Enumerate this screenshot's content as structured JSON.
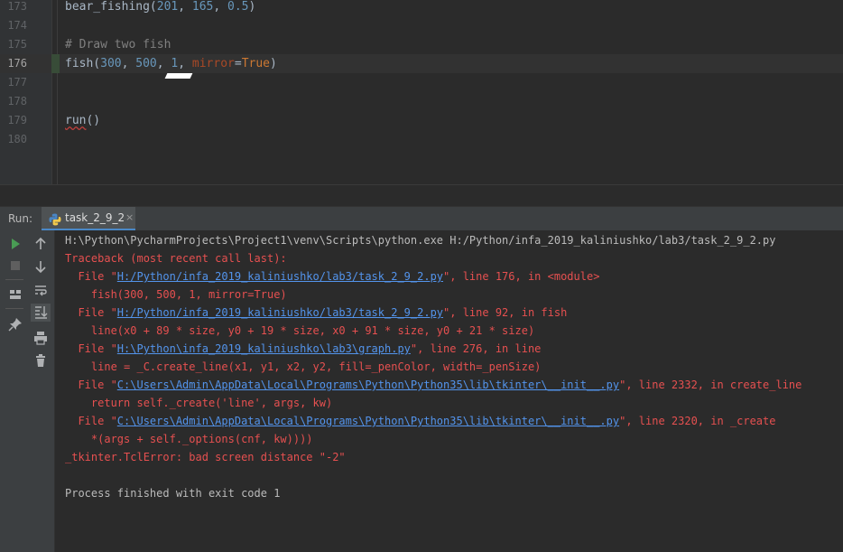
{
  "editor": {
    "lines": [
      {
        "num": "173",
        "parts": [
          {
            "t": "bear_fishing(",
            "c": ""
          },
          {
            "t": "201",
            "c": "num"
          },
          {
            "t": ", ",
            "c": ""
          },
          {
            "t": "165",
            "c": "num"
          },
          {
            "t": ", ",
            "c": ""
          },
          {
            "t": "0.5",
            "c": "num hl"
          },
          {
            "t": ")",
            "c": ""
          }
        ]
      },
      {
        "num": "174",
        "parts": []
      },
      {
        "num": "175",
        "parts": [
          {
            "t": "# Draw two fish",
            "c": "cm"
          }
        ]
      },
      {
        "num": "176",
        "current": true,
        "parts": [
          {
            "t": "fish(",
            "c": ""
          },
          {
            "t": "300",
            "c": "num"
          },
          {
            "t": ", ",
            "c": ""
          },
          {
            "t": "500",
            "c": "num"
          },
          {
            "t": ", ",
            "c": ""
          },
          {
            "t": "1",
            "c": "num"
          },
          {
            "t": ", ",
            "c": ""
          },
          {
            "t": "mirror",
            "c": "kw"
          },
          {
            "t": "=",
            "c": ""
          },
          {
            "t": "True",
            "c": "kwv"
          },
          {
            "t": ")",
            "c": ""
          }
        ]
      },
      {
        "num": "177",
        "parts": []
      },
      {
        "num": "178",
        "parts": []
      },
      {
        "num": "179",
        "parts": [
          {
            "t": "run",
            "c": "run"
          },
          {
            "t": "()",
            "c": ""
          }
        ]
      },
      {
        "num": "180",
        "parts": []
      }
    ]
  },
  "run_panel": {
    "label": "Run:",
    "tab": {
      "label": "task_2_9_2",
      "close": "×"
    },
    "toolbar_icons": [
      "play-icon",
      "stop-icon",
      "arrow-up-icon",
      "arrow-down-icon",
      "soft-wrap-icon",
      "scroll-to-end-icon",
      "layout-icon",
      "pin-icon",
      "print-icon",
      "trash-icon"
    ]
  },
  "console": {
    "lines": [
      {
        "kind": "plain",
        "parts": [
          {
            "t": "H:\\Python\\PycharmProjects\\Project1\\venv\\Scripts\\python.exe H:/Python/infa_2019_kaliniushko/lab3/task_2_9_2.py"
          }
        ]
      },
      {
        "kind": "err",
        "parts": [
          {
            "t": "Traceback (most recent call last):"
          }
        ]
      },
      {
        "kind": "err",
        "parts": [
          {
            "t": "  File \""
          },
          {
            "t": "H:/Python/infa_2019_kaliniushko/lab3/task_2_9_2.py",
            "link": true
          },
          {
            "t": "\", line 176, in <module>"
          }
        ]
      },
      {
        "kind": "err",
        "parts": [
          {
            "t": "    fish(300, 500, 1, mirror=True)"
          }
        ]
      },
      {
        "kind": "err",
        "parts": [
          {
            "t": "  File \""
          },
          {
            "t": "H:/Python/infa_2019_kaliniushko/lab3/task_2_9_2.py",
            "link": true
          },
          {
            "t": "\", line 92, in fish"
          }
        ]
      },
      {
        "kind": "err",
        "parts": [
          {
            "t": "    line(x0 + 89 * size, y0 + 19 * size, x0 + 91 * size, y0 + 21 * size)"
          }
        ]
      },
      {
        "kind": "err",
        "parts": [
          {
            "t": "  File \""
          },
          {
            "t": "H:\\Python\\infa_2019_kaliniushko\\lab3\\graph.py",
            "link": true
          },
          {
            "t": "\", line 276, in line"
          }
        ]
      },
      {
        "kind": "err",
        "parts": [
          {
            "t": "    line = _C.create_line(x1, y1, x2, y2, fill=_penColor, width=_penSize)"
          }
        ]
      },
      {
        "kind": "err",
        "parts": [
          {
            "t": "  File \""
          },
          {
            "t": "C:\\Users\\Admin\\AppData\\Local\\Programs\\Python\\Python35\\lib\\tkinter\\__init__.py",
            "link": true
          },
          {
            "t": "\", line 2332, in create_line"
          }
        ]
      },
      {
        "kind": "err",
        "parts": [
          {
            "t": "    return self._create('line', args, kw)"
          }
        ]
      },
      {
        "kind": "err",
        "parts": [
          {
            "t": "  File \""
          },
          {
            "t": "C:\\Users\\Admin\\AppData\\Local\\Programs\\Python\\Python35\\lib\\tkinter\\__init__.py",
            "link": true
          },
          {
            "t": "\", line 2320, in _create"
          }
        ]
      },
      {
        "kind": "err",
        "parts": [
          {
            "t": "    *(args + self._options(cnf, kw))))"
          }
        ]
      },
      {
        "kind": "err",
        "parts": [
          {
            "t": "_tkinter.TclError: bad screen distance \"-2\""
          }
        ]
      },
      {
        "kind": "plain",
        "parts": [
          {
            "t": ""
          }
        ]
      },
      {
        "kind": "plain",
        "parts": [
          {
            "t": "Process finished with exit code 1"
          }
        ]
      }
    ]
  },
  "colors": {
    "background": "#2b2b2b",
    "error_text": "#e65050",
    "link": "#5394ec",
    "number": "#6897bb",
    "comment": "#808080",
    "keyword_arg": "#aa4926",
    "keyword": "#cc7832"
  }
}
